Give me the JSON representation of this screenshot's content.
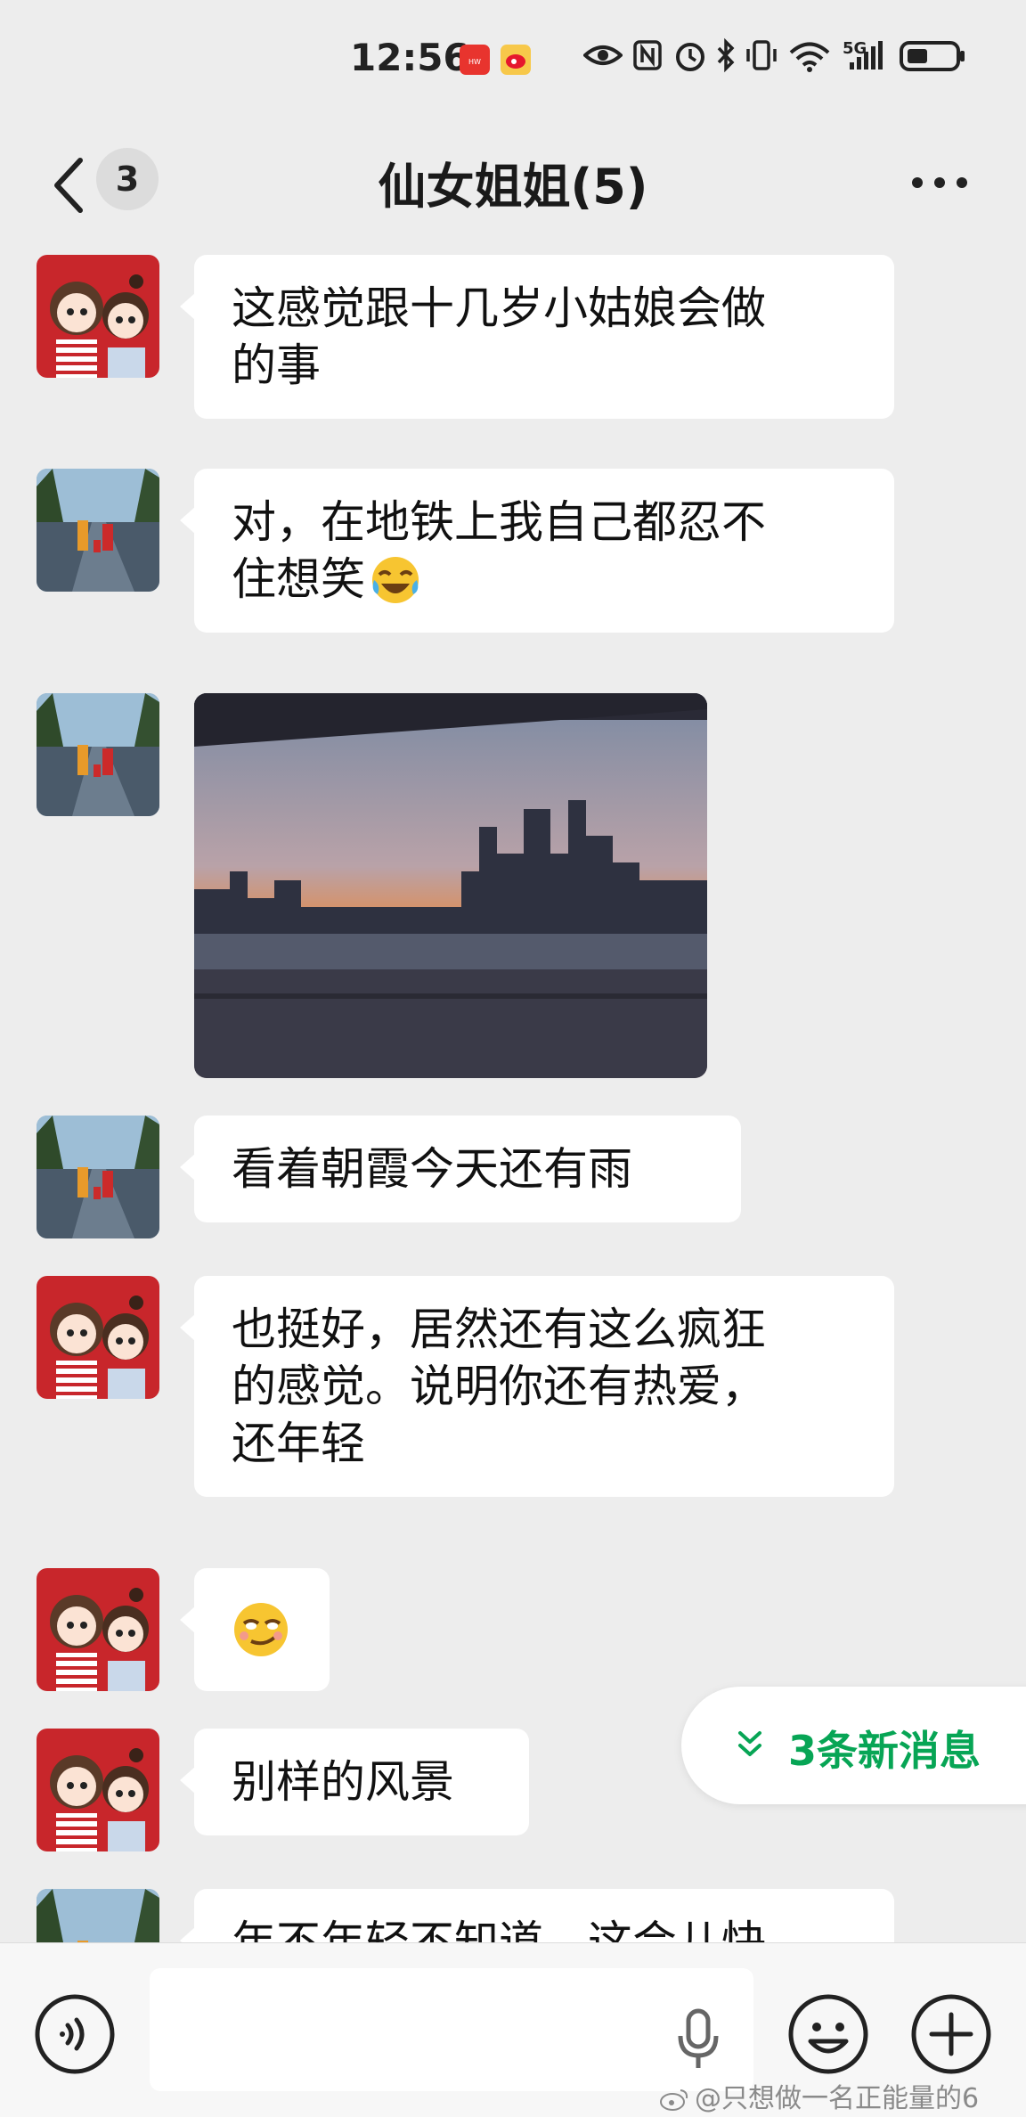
{
  "status_bar": {
    "time": "12:56",
    "network_label": "5G",
    "icons": [
      "huawei-app-icon",
      "weibo-app-icon",
      "eye-icon",
      "nfc-icon",
      "alarm-icon",
      "bluetooth-icon",
      "vibrate-icon",
      "wifi-icon",
      "signal-icon",
      "battery-icon"
    ]
  },
  "header": {
    "back_badge": "3",
    "title": "仙女姐姐(5)"
  },
  "messages": [
    {
      "type": "text",
      "avatar": "cartoon-girls-avatar",
      "text_lines": [
        "这感觉跟十几岁小姑娘会做",
        "的事"
      ]
    },
    {
      "type": "text",
      "avatar": "street-kids-avatar",
      "text_lines": [
        "对，在地铁上我自己都忍不",
        "住想笑"
      ],
      "emoji": "laugh-cry-emoji"
    },
    {
      "type": "image",
      "avatar": "street-kids-avatar",
      "image": "sunset-city-photo"
    },
    {
      "type": "text",
      "avatar": "street-kids-avatar",
      "text_lines": [
        "看着朝霞今天还有雨"
      ]
    },
    {
      "type": "text",
      "avatar": "cartoon-girls-avatar",
      "text_lines": [
        "也挺好，居然还有这么疯狂",
        "的感觉。说明你还有热爱，",
        "还年轻"
      ]
    },
    {
      "type": "emoji",
      "avatar": "cartoon-girls-avatar",
      "emoji": "smirk-emoji"
    },
    {
      "type": "text",
      "avatar": "cartoon-girls-avatar",
      "text_lines": [
        "别样的风景"
      ]
    },
    {
      "type": "text",
      "avatar": "street-kids-avatar",
      "text_lines": [
        "年不年轻不知道，这会儿快"
      ]
    }
  ],
  "new_messages": {
    "label": "3条新消息"
  },
  "input_bar": {
    "placeholder": ""
  },
  "watermark": "@只想做一名正能量的6",
  "colors": {
    "accent_green": "#07a555",
    "background": "#ededed",
    "bubble": "#ffffff"
  }
}
